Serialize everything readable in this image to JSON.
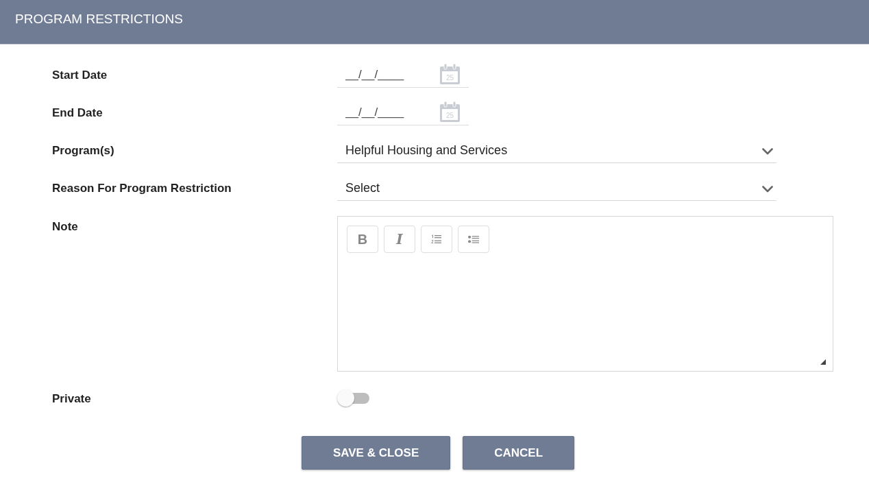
{
  "header": {
    "title": "PROGRAM RESTRICTIONS"
  },
  "fields": [
    {
      "kind": "date",
      "label": "Start Date",
      "placeholder": "__/__/____",
      "icon_day": "25"
    },
    {
      "kind": "date",
      "label": "End Date",
      "placeholder": "__/__/____",
      "icon_day": "25"
    },
    {
      "kind": "select",
      "label": "Program(s)",
      "value": "Helpful Housing and Services"
    },
    {
      "kind": "select",
      "label": "Reason For Program Restriction",
      "value": "Select"
    },
    {
      "kind": "editor",
      "label": "Note",
      "toolbar": [
        {
          "kind": "bold",
          "label": "B"
        },
        {
          "kind": "italic",
          "label": "I"
        },
        {
          "kind": "ordered_list"
        },
        {
          "kind": "bullet_list"
        }
      ]
    },
    {
      "kind": "toggle",
      "label": "Private",
      "on": false
    }
  ],
  "buttons": [
    {
      "label": "SAVE & CLOSE"
    },
    {
      "label": "CANCEL"
    }
  ]
}
